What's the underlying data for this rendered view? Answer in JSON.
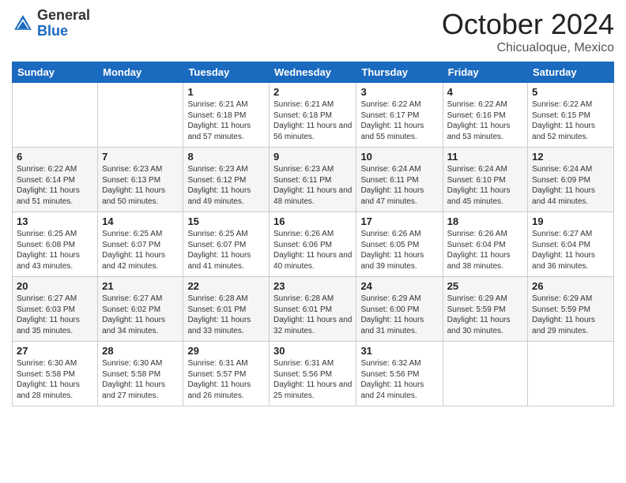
{
  "header": {
    "logo_general": "General",
    "logo_blue": "Blue",
    "month_title": "October 2024",
    "location": "Chicualoque, Mexico"
  },
  "weekdays": [
    "Sunday",
    "Monday",
    "Tuesday",
    "Wednesday",
    "Thursday",
    "Friday",
    "Saturday"
  ],
  "weeks": [
    [
      {
        "day": "",
        "info": ""
      },
      {
        "day": "",
        "info": ""
      },
      {
        "day": "1",
        "info": "Sunrise: 6:21 AM\nSunset: 6:18 PM\nDaylight: 11 hours and 57 minutes."
      },
      {
        "day": "2",
        "info": "Sunrise: 6:21 AM\nSunset: 6:18 PM\nDaylight: 11 hours and 56 minutes."
      },
      {
        "day": "3",
        "info": "Sunrise: 6:22 AM\nSunset: 6:17 PM\nDaylight: 11 hours and 55 minutes."
      },
      {
        "day": "4",
        "info": "Sunrise: 6:22 AM\nSunset: 6:16 PM\nDaylight: 11 hours and 53 minutes."
      },
      {
        "day": "5",
        "info": "Sunrise: 6:22 AM\nSunset: 6:15 PM\nDaylight: 11 hours and 52 minutes."
      }
    ],
    [
      {
        "day": "6",
        "info": "Sunrise: 6:22 AM\nSunset: 6:14 PM\nDaylight: 11 hours and 51 minutes."
      },
      {
        "day": "7",
        "info": "Sunrise: 6:23 AM\nSunset: 6:13 PM\nDaylight: 11 hours and 50 minutes."
      },
      {
        "day": "8",
        "info": "Sunrise: 6:23 AM\nSunset: 6:12 PM\nDaylight: 11 hours and 49 minutes."
      },
      {
        "day": "9",
        "info": "Sunrise: 6:23 AM\nSunset: 6:11 PM\nDaylight: 11 hours and 48 minutes."
      },
      {
        "day": "10",
        "info": "Sunrise: 6:24 AM\nSunset: 6:11 PM\nDaylight: 11 hours and 47 minutes."
      },
      {
        "day": "11",
        "info": "Sunrise: 6:24 AM\nSunset: 6:10 PM\nDaylight: 11 hours and 45 minutes."
      },
      {
        "day": "12",
        "info": "Sunrise: 6:24 AM\nSunset: 6:09 PM\nDaylight: 11 hours and 44 minutes."
      }
    ],
    [
      {
        "day": "13",
        "info": "Sunrise: 6:25 AM\nSunset: 6:08 PM\nDaylight: 11 hours and 43 minutes."
      },
      {
        "day": "14",
        "info": "Sunrise: 6:25 AM\nSunset: 6:07 PM\nDaylight: 11 hours and 42 minutes."
      },
      {
        "day": "15",
        "info": "Sunrise: 6:25 AM\nSunset: 6:07 PM\nDaylight: 11 hours and 41 minutes."
      },
      {
        "day": "16",
        "info": "Sunrise: 6:26 AM\nSunset: 6:06 PM\nDaylight: 11 hours and 40 minutes."
      },
      {
        "day": "17",
        "info": "Sunrise: 6:26 AM\nSunset: 6:05 PM\nDaylight: 11 hours and 39 minutes."
      },
      {
        "day": "18",
        "info": "Sunrise: 6:26 AM\nSunset: 6:04 PM\nDaylight: 11 hours and 38 minutes."
      },
      {
        "day": "19",
        "info": "Sunrise: 6:27 AM\nSunset: 6:04 PM\nDaylight: 11 hours and 36 minutes."
      }
    ],
    [
      {
        "day": "20",
        "info": "Sunrise: 6:27 AM\nSunset: 6:03 PM\nDaylight: 11 hours and 35 minutes."
      },
      {
        "day": "21",
        "info": "Sunrise: 6:27 AM\nSunset: 6:02 PM\nDaylight: 11 hours and 34 minutes."
      },
      {
        "day": "22",
        "info": "Sunrise: 6:28 AM\nSunset: 6:01 PM\nDaylight: 11 hours and 33 minutes."
      },
      {
        "day": "23",
        "info": "Sunrise: 6:28 AM\nSunset: 6:01 PM\nDaylight: 11 hours and 32 minutes."
      },
      {
        "day": "24",
        "info": "Sunrise: 6:29 AM\nSunset: 6:00 PM\nDaylight: 11 hours and 31 minutes."
      },
      {
        "day": "25",
        "info": "Sunrise: 6:29 AM\nSunset: 5:59 PM\nDaylight: 11 hours and 30 minutes."
      },
      {
        "day": "26",
        "info": "Sunrise: 6:29 AM\nSunset: 5:59 PM\nDaylight: 11 hours and 29 minutes."
      }
    ],
    [
      {
        "day": "27",
        "info": "Sunrise: 6:30 AM\nSunset: 5:58 PM\nDaylight: 11 hours and 28 minutes."
      },
      {
        "day": "28",
        "info": "Sunrise: 6:30 AM\nSunset: 5:58 PM\nDaylight: 11 hours and 27 minutes."
      },
      {
        "day": "29",
        "info": "Sunrise: 6:31 AM\nSunset: 5:57 PM\nDaylight: 11 hours and 26 minutes."
      },
      {
        "day": "30",
        "info": "Sunrise: 6:31 AM\nSunset: 5:56 PM\nDaylight: 11 hours and 25 minutes."
      },
      {
        "day": "31",
        "info": "Sunrise: 6:32 AM\nSunset: 5:56 PM\nDaylight: 11 hours and 24 minutes."
      },
      {
        "day": "",
        "info": ""
      },
      {
        "day": "",
        "info": ""
      }
    ]
  ]
}
